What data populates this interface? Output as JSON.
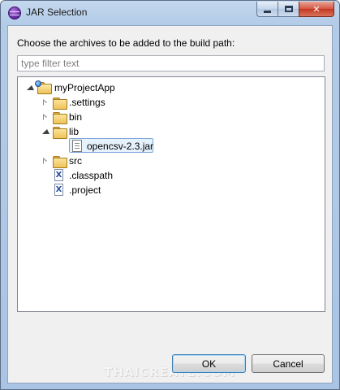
{
  "window": {
    "title": "JAR Selection",
    "controls": {
      "minimize": "minimize",
      "maximize": "maximize",
      "close": "✕"
    }
  },
  "dialog": {
    "prompt": "Choose the archives to be added to the build path:",
    "filter_placeholder": "type filter text"
  },
  "tree": {
    "project": "myProjectApp",
    "settings": ".settings",
    "bin": "bin",
    "lib": "lib",
    "jar": "opencsv-2.3.jar",
    "src": "src",
    "classpath": ".classpath",
    "projectfile": ".project"
  },
  "buttons": {
    "ok": "OK",
    "cancel": "Cancel"
  },
  "watermark": "THAICREATE.COM",
  "colors": {
    "selection_fill": "#e5f1fb",
    "selection_border": "#7ca5d8",
    "folder": "#eec25a",
    "close_button": "#c43821"
  }
}
